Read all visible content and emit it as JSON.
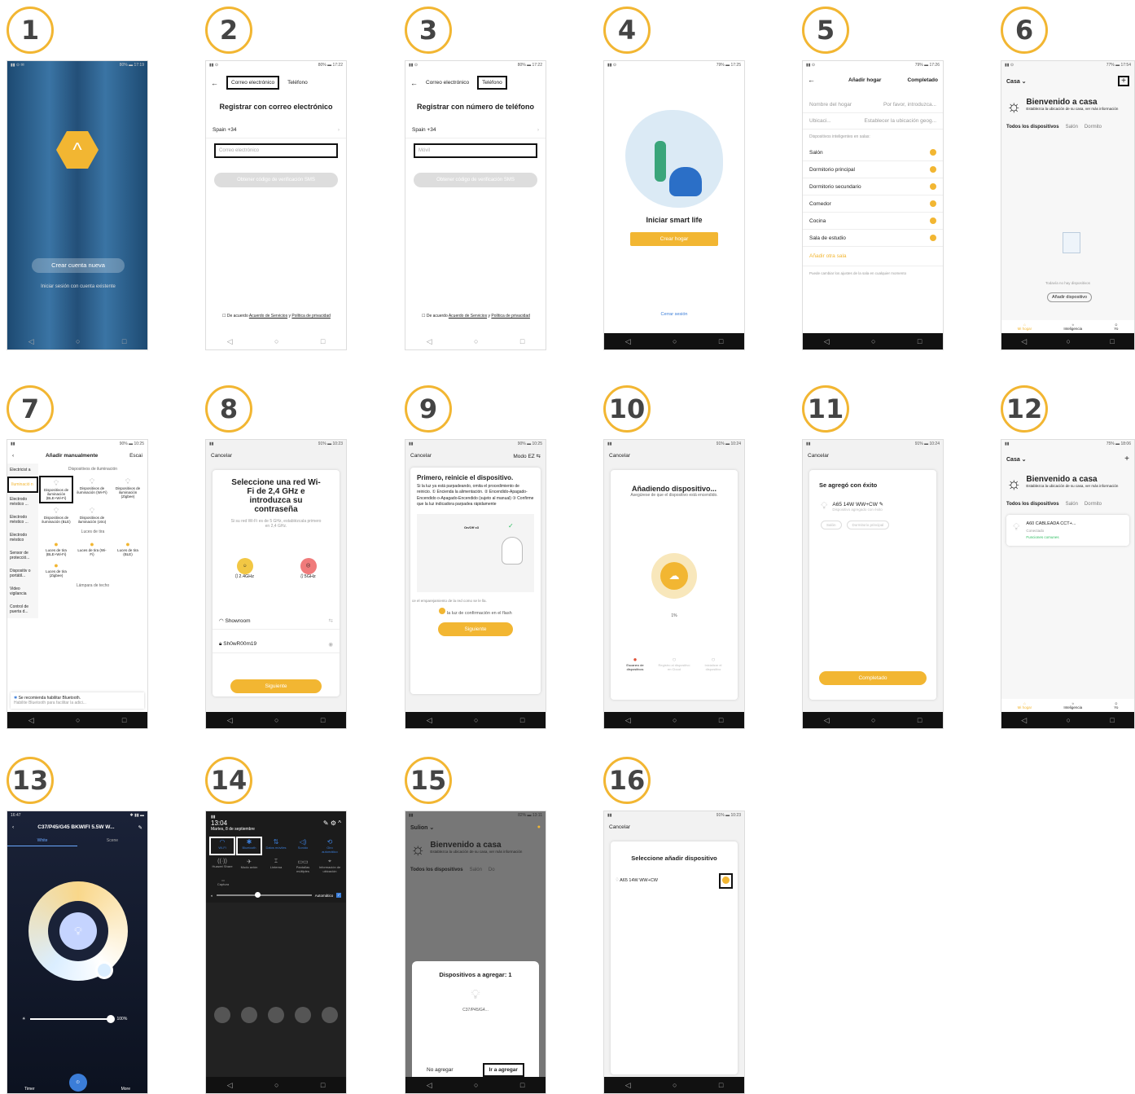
{
  "steps": [
    "1",
    "2",
    "3",
    "4",
    "5",
    "6",
    "7",
    "8",
    "9",
    "10",
    "11",
    "12",
    "13",
    "14",
    "15",
    "16"
  ],
  "nav": {
    "back": "◁",
    "home": "○",
    "recent": "□"
  },
  "s1": {
    "create": "Crear cuenta nueva",
    "login": "Iniciar sesión con cuenta existente"
  },
  "s2": {
    "tab_email": "Correo electrónico",
    "tab_phone": "Teléfono",
    "title": "Registrar con correo electrónico",
    "country": "Spain +34",
    "placeholder": "Correo electrónico",
    "sms": "Obtener código de verificación SMS",
    "terms_a": "De acuerdo ",
    "terms_link1": "Acuerdo de Servicios",
    "terms_y": " y ",
    "terms_link2": "Política de privacidad"
  },
  "s3": {
    "title": "Registrar con número de teléfono",
    "placeholder": "Móvil"
  },
  "s4": {
    "title": "Iniciar smart life",
    "btn": "Crear hogar",
    "logout": "Cerrar sesión"
  },
  "s5": {
    "title": "Añadir hogar",
    "done": "Completado",
    "name_l": "Nombre del hogar",
    "name_p": "Por favor, introduzca...",
    "loc_l": "Ubicaci...",
    "loc_p": "Establecer la ubicación geog...",
    "rooms_h": "Dispositivos inteligentes en salas:",
    "rooms": [
      "Salón",
      "Dormitorio principal",
      "Dormitorio secundario",
      "Comedor",
      "Cocina",
      "Sala de estudio"
    ],
    "add_room": "Añadir otra sala",
    "foot": "Puede cambiar los ajustes de la sala en cualquier momento"
  },
  "s6": {
    "home": "Casa ⌄",
    "welcome": "Bienvenido a casa",
    "sub": "Establezca la ubicación de su casa, ver más información",
    "tabs": [
      "Todos los dispositivos",
      "Salón",
      "Dormito"
    ],
    "empty": "Todavía no hay dispositivos",
    "add": "Añadir dispositivo",
    "bottom": [
      "Mi hogar",
      "Inteligencia",
      "Yo"
    ]
  },
  "s7": {
    "title": "Añadir manualmente",
    "scan": "Escai",
    "cats": [
      "Electricist a",
      "Iluminació n",
      "Electrodo méstico ...",
      "Electrodo méstico ...",
      "Electrodo méstico",
      "Sensor de protecció...",
      "Dispositiv o portátil...",
      "Video vigilancia",
      "Control de puerta d..."
    ],
    "h1": "Dispositivos de iluminación",
    "items1": [
      "Dispositivos de iluminación (BLE+Wi-Fi)",
      "Dispositivos de iluminación (Wi-Fi)",
      "Dispositivos de iluminación (Zigbee)",
      "Dispositivos de iluminación (BLE)",
      "Dispositivos de iluminación (otro)"
    ],
    "h2": "Luces de tira",
    "items2": [
      "Luces de tira (BLE+Wi-Fi)",
      "Luces de tira (Wi-Fi)",
      "Luces de tira (BLE)",
      "Luces de tira (Zigbee)"
    ],
    "h3": "Lámpara de techo",
    "bt1": "Se recomienda habilitar Bluetooth.",
    "bt2": "Habilite Bluetooth para facilitar la adici..."
  },
  "s8": {
    "cancel": "Cancelar",
    "title": "Seleccione una red Wi-Fi de 2,4 GHz e introduzca su contraseña",
    "sub": "Si su red Wi-Fi es de 5 GHz, establézcala primero en 2,4 GHz.",
    "f1": "2.4GHz",
    "f2": "5GHz",
    "ssid": "Showroom",
    "pwd": "Sh0wR00m19",
    "btn": "Siguiente"
  },
  "s9": {
    "cancel": "Cancelar",
    "mode": "Modo EZ ⇆",
    "title": "Primero, reinicie el dispositivo.",
    "body": "Si la luz ya está parpadeando, omita el procedimiento de reinicio. ① Encienda la alimentación. ② Encendido-Apagado-Encendido o-Apagado-Encendido (sujeto al manual) ③ Confirme que la luz indicadora parpadea rápidamente",
    "onoff": "On/Off x3",
    "pair": "ce el emparejamiento de la red como se le lla.",
    "confirm": "la luz de confirmación en el flash",
    "btn": "Siguiente"
  },
  "s10": {
    "cancel": "Cancelar",
    "title": "Añadiendo dispositivo...",
    "sub": "Asegúrese de que el dispositivo está encendido.",
    "pct": "1%",
    "st": [
      "Escaneo de dispositivos",
      "Registro al dispositivo en Cloud",
      "Inicializar el dispositivo"
    ]
  },
  "s11": {
    "cancel": "Cancelar",
    "title": "Se agregó con éxito",
    "dev": "A65 14W WW+CW",
    "ok": "Dispositivo agregado con éxito",
    "r1": "Salón",
    "r2": "Dormitorio principal",
    "btn": "Completado"
  },
  "s12": {
    "dev": "A60 CABLEADA CCT+...",
    "conn": "Conectado",
    "fn": "Funciones comunes"
  },
  "s13": {
    "time": "16:47",
    "title": "C37/P45/G45 BKWIFI 5.5W W...",
    "t1": "White",
    "t2": "Scene",
    "pct": "100%",
    "timer": "Timer",
    "more": "More"
  },
  "s14": {
    "time": "13:04",
    "date": "Martes, 8 de septiembre",
    "row1": [
      "Wi-Fi",
      "Bluetooth",
      "Datos móviles",
      "Sonido",
      "Giro automático"
    ],
    "row2": [
      "Huawei Share",
      "Modo avión",
      "Linterna",
      "Pantallas múltiples",
      "Información de ubicación"
    ],
    "cap": "Captura",
    "auto": "Automático"
  },
  "s15": {
    "home": "Sulion ⌄",
    "tabs": [
      "Todos los dispositivos",
      "Salón",
      "Do"
    ],
    "title": "Dispositivos a agregar: 1",
    "dev": "C37/P45/G4...",
    "no": "No agregar",
    "go": "Ir a agregar"
  },
  "s16": {
    "cancel": "Cancelar",
    "title": "Seleccione añadir dispositivo",
    "dev": "A65 14W WW+CW"
  },
  "colors": {
    "accent": "#f2b632"
  }
}
